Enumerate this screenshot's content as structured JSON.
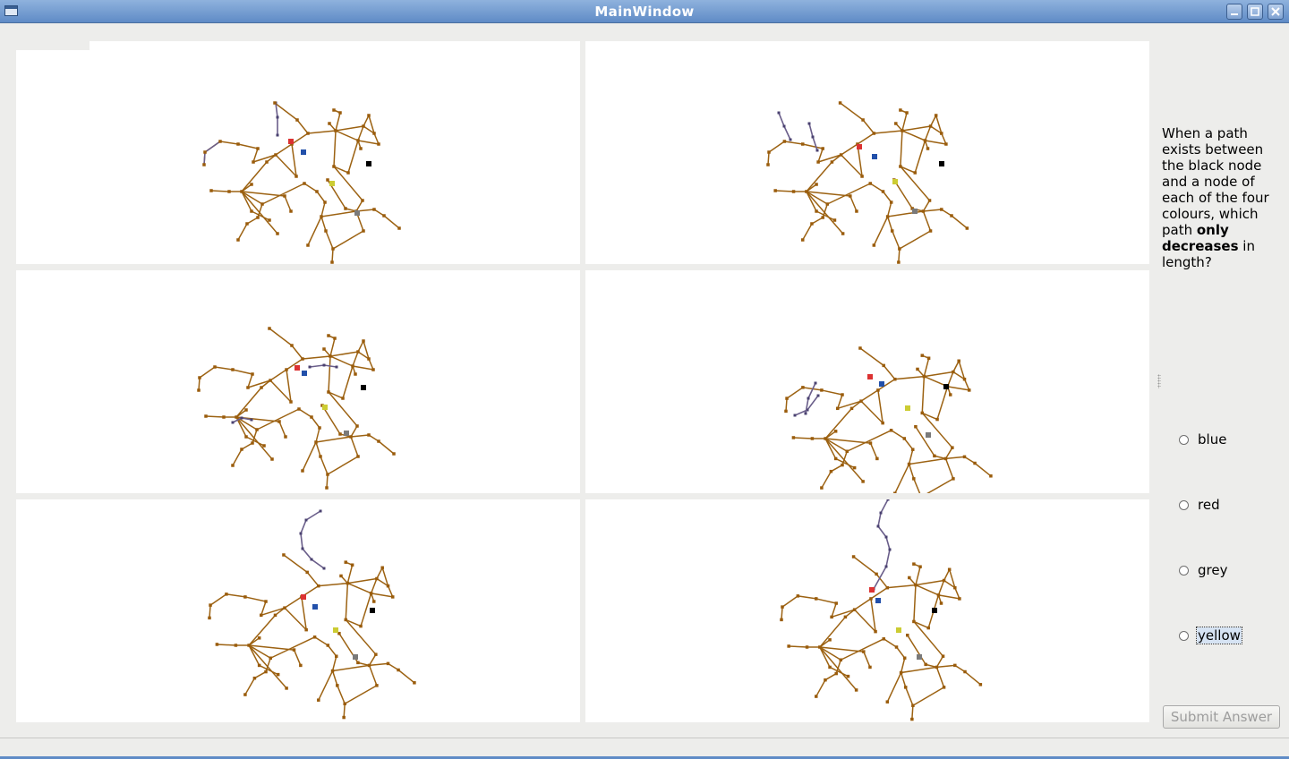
{
  "window": {
    "title": "MainWindow"
  },
  "question": {
    "part1": "When a path exists between the black node and a node of each of the four colours, which path ",
    "bold1": "only",
    "part2": " ",
    "bold2": "decreases",
    "part3": " in length?"
  },
  "options": [
    {
      "label": "blue",
      "selected": false
    },
    {
      "label": "red",
      "selected": false
    },
    {
      "label": "grey",
      "selected": false
    },
    {
      "label": "yellow",
      "selected": false,
      "focused": true
    }
  ],
  "submit_label": "Submit Answer",
  "colors": {
    "edge": "#9c6212",
    "node": "#9a5c0c",
    "path": "#6a5e8a",
    "red": "#dc3232",
    "blue": "#2250aa",
    "grey": "#7a7a7a",
    "yellow": "#cccc33",
    "black": "#000000",
    "titlebar": "#6f98cf"
  }
}
